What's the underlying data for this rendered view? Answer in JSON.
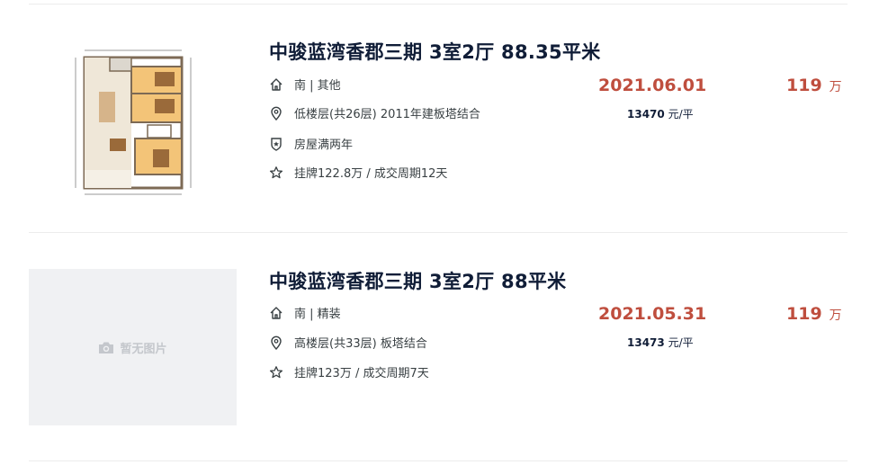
{
  "listings": [
    {
      "title": "中骏蓝湾香郡三期 3室2厅 88.35平米",
      "orientation": "南 | 其他",
      "floor": "低楼层(共26层) 2011年建板塔结合",
      "tag": "房屋满两年",
      "listing": "挂牌122.8万 / 成交周期12天",
      "deal_date": "2021.06.01",
      "total_price": "119",
      "total_unit": "万",
      "unit_price": "13470",
      "unit_price_suffix": "元/平",
      "has_floorplan": true
    },
    {
      "title": "中骏蓝湾香郡三期 3室2厅 88平米",
      "orientation": "南 | 精装",
      "floor": "高楼层(共33层) 板塔结合",
      "listing": "挂牌123万 / 成交周期7天",
      "deal_date": "2021.05.31",
      "total_price": "119",
      "total_unit": "万",
      "unit_price": "13473",
      "unit_price_suffix": "元/平",
      "placeholder": "暂无图片",
      "has_floorplan": false
    }
  ],
  "icons": {
    "orientation": "house-icon",
    "floor": "location-pin-icon",
    "tag": "shield-icon",
    "listing": "star-icon",
    "placeholder": "camera-icon"
  },
  "colors": {
    "price": "#bf4e3e",
    "title": "#101d37",
    "placeholder_bg": "#f0f1f3"
  }
}
